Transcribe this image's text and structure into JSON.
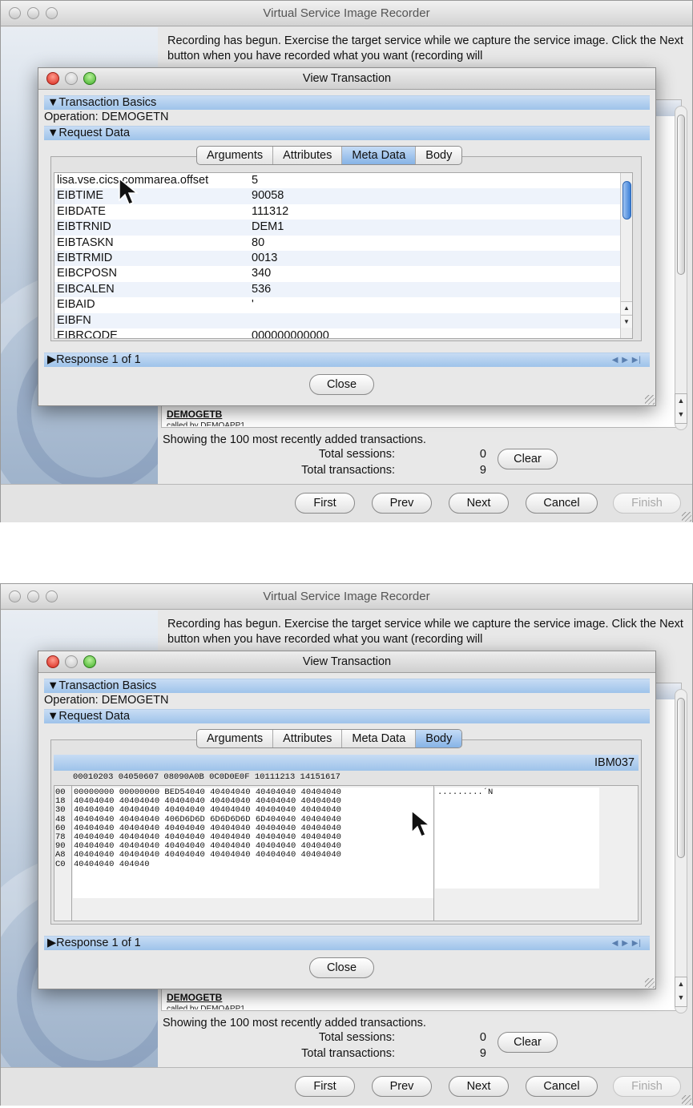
{
  "shots": [
    {
      "outer": {
        "title": "Virtual Service Image Recorder",
        "instructions": "Recording has begun.  Exercise the target service while we capture the service image.  Click the Next button when you have recorded what you want (recording will",
        "list_item_label": "DEMOGETB",
        "list_item_sub": "called by DEMOAPP1",
        "showing_text": "Showing the 100 most recently added transactions.",
        "total_sessions_label": "Total sessions:",
        "total_sessions_value": "0",
        "total_transactions_label": "Total transactions:",
        "total_transactions_value": "9",
        "clear_label": "Clear",
        "buttons": {
          "first": "First",
          "prev": "Prev",
          "next": "Next",
          "cancel": "Cancel",
          "finish": "Finish"
        }
      },
      "dialog": {
        "title": "View Transaction",
        "transaction_basics": "▼Transaction Basics",
        "operation": "Operation: DEMOGETN",
        "request_data": "▼Request Data",
        "tabs": [
          "Arguments",
          "Attributes",
          "Meta Data",
          "Body"
        ],
        "active_tab": "Meta Data",
        "meta_rows": [
          {
            "key": "lisa.vse.cics.commarea.offset",
            "value": "5"
          },
          {
            "key": "EIBTIME",
            "value": "90058"
          },
          {
            "key": "EIBDATE",
            "value": "111312"
          },
          {
            "key": "EIBTRNID",
            "value": "DEM1"
          },
          {
            "key": "EIBTASKN",
            "value": "80"
          },
          {
            "key": "EIBTRMID",
            "value": "0013"
          },
          {
            "key": "EIBCPOSN",
            "value": "340"
          },
          {
            "key": "EIBCALEN",
            "value": "536"
          },
          {
            "key": "EIBAID",
            "value": "'"
          },
          {
            "key": "EIBFN",
            "value": ""
          },
          {
            "key": "EIBRCODE",
            "value": "000000000000"
          }
        ],
        "response": "▶Response 1 of 1",
        "close_label": "Close"
      }
    },
    {
      "outer": {
        "title": "Virtual Service Image Recorder",
        "instructions": "Recording has begun.  Exercise the target service while we capture the service image.  Click the Next button when you have recorded what you want (recording will",
        "list_item_label": "DEMOGETB",
        "list_item_sub": "called by DEMOAPP1",
        "showing_text": "Showing the 100 most recently added transactions.",
        "total_sessions_label": "Total sessions:",
        "total_sessions_value": "0",
        "total_transactions_label": "Total transactions:",
        "total_transactions_value": "9",
        "clear_label": "Clear",
        "buttons": {
          "first": "First",
          "prev": "Prev",
          "next": "Next",
          "cancel": "Cancel",
          "finish": "Finish"
        }
      },
      "dialog": {
        "title": "View Transaction",
        "transaction_basics": "▼Transaction Basics",
        "operation": "Operation: DEMOGETN",
        "request_data": "▼Request Data",
        "tabs": [
          "Arguments",
          "Attributes",
          "Meta Data",
          "Body"
        ],
        "active_tab": "Body",
        "encoding": "IBM037",
        "hex_header": "00010203 04050607 08090A0B 0C0D0E0F 10111213 14151617",
        "hex_offsets": [
          "00",
          "18",
          "30",
          "48",
          "60",
          "78",
          "90",
          "A8",
          "C0"
        ],
        "hex_lines": [
          "00000000 00000000 BED54040 40404040 40404040 40404040",
          "40404040 40404040 40404040 40404040 40404040 40404040",
          "40404040 40404040 40404040 40404040 40404040 40404040",
          "40404040 40404040 406D6D6D 6D6D6D6D 6D404040 40404040",
          "40404040 40404040 40404040 40404040 40404040 40404040",
          "40404040 40404040 40404040 40404040 40404040 40404040",
          "40404040 40404040 40404040 40404040 40404040 40404040",
          "40404040 40404040 40404040 40404040 40404040 40404040",
          "40404040 404040"
        ],
        "hex_text": ".........´N",
        "response": "▶Response 1 of 1",
        "close_label": "Close"
      }
    }
  ]
}
